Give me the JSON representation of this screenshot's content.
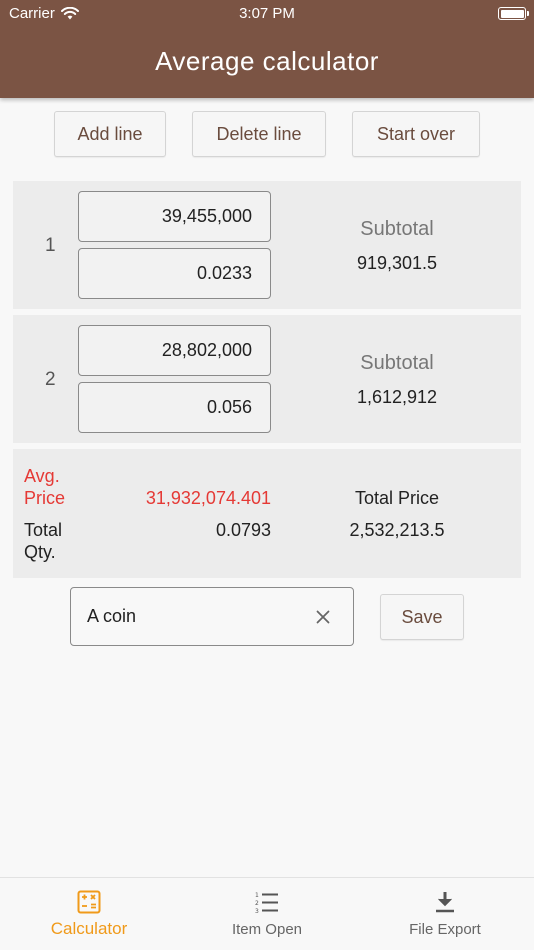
{
  "status_bar": {
    "carrier": "Carrier",
    "time": "3:07 PM"
  },
  "app": {
    "title": "Average calculator"
  },
  "toolbar": {
    "add_label": "Add line",
    "delete_label": "Delete line",
    "start_over_label": "Start over"
  },
  "lines": [
    {
      "index": "1",
      "price": "39,455,000",
      "qty": "0.0233",
      "subtotal_label": "Subtotal",
      "subtotal": "919,301.5"
    },
    {
      "index": "2",
      "price": "28,802,000",
      "qty": "0.056",
      "subtotal_label": "Subtotal",
      "subtotal": "1,612,912"
    }
  ],
  "summary": {
    "avg_label_1": "Avg.",
    "avg_label_2": "Price",
    "avg_value": "31,932,074.401",
    "total_price_label": "Total Price",
    "total_qty_label_1": "Total",
    "total_qty_label_2": "Qty.",
    "total_qty_value": "0.0793",
    "total_price_value": "2,532,213.5"
  },
  "save_form": {
    "name_value": "A coin",
    "save_label": "Save"
  },
  "bottom_nav": [
    {
      "label": "Calculator",
      "icon": "calculator-icon",
      "active": true
    },
    {
      "label": "Item Open",
      "icon": "list-icon",
      "active": false
    },
    {
      "label": "File Export",
      "icon": "download-icon",
      "active": false
    }
  ],
  "colors": {
    "header": "#7b5444",
    "accent": "#f09a1a",
    "highlight_red": "#e53935",
    "button_text": "#6a4c3e"
  }
}
